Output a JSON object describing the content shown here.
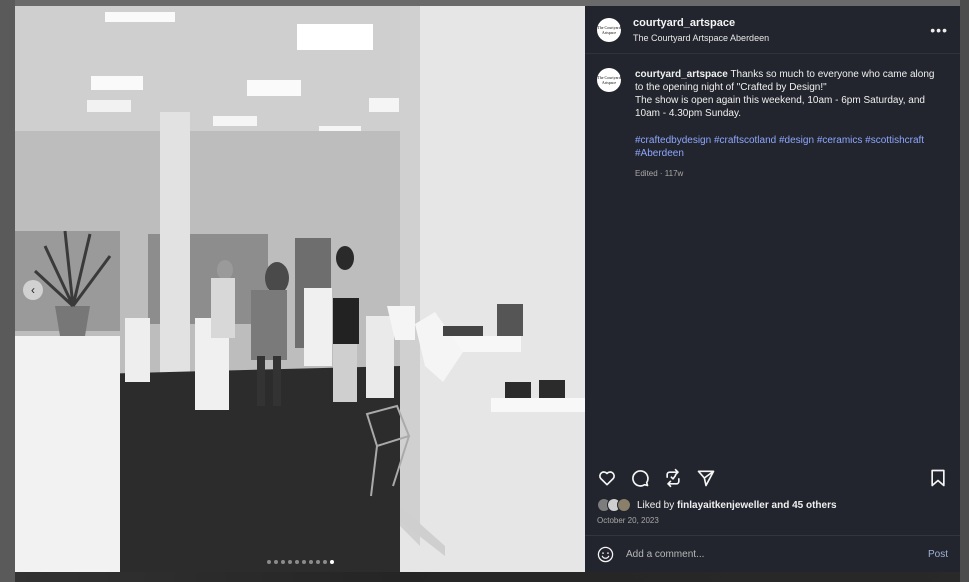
{
  "post": {
    "username": "courtyard_artspace",
    "location": "The Courtyard Artspace Aberdeen",
    "avatar_text": "The Courtyard Artspace",
    "caption_line1": "Thanks so much to everyone who came along to the opening night of \"Crafted by Design!\"",
    "caption_line2": "The show is open again this weekend, 10am - 6pm Saturday, and 10am - 4.30pm Sunday.",
    "hashtags": [
      "#craftedbydesign",
      "#craftscotland",
      "#design",
      "#ceramics",
      "#scottishcraft",
      "#Aberdeen"
    ],
    "edited_label": "Edited",
    "age": "117w",
    "liked_by_prefix": "Liked by",
    "liked_by_user": "finlayaitkenjeweller",
    "liked_by_suffix": "and",
    "others": "45 others",
    "date": "October 20, 2023"
  },
  "carousel": {
    "count": 10,
    "active": 9
  },
  "comment_box": {
    "placeholder": "Add a comment...",
    "post_label": "Post"
  },
  "icons": [
    "more-icon",
    "heart-icon",
    "comment-icon",
    "repost-icon",
    "share-icon",
    "bookmark-icon",
    "emoji-icon",
    "chevron-left-icon"
  ],
  "colors": {
    "panel": "#22252d",
    "hashtag": "#8ea6ff",
    "post_button": "#9fb0d8"
  }
}
